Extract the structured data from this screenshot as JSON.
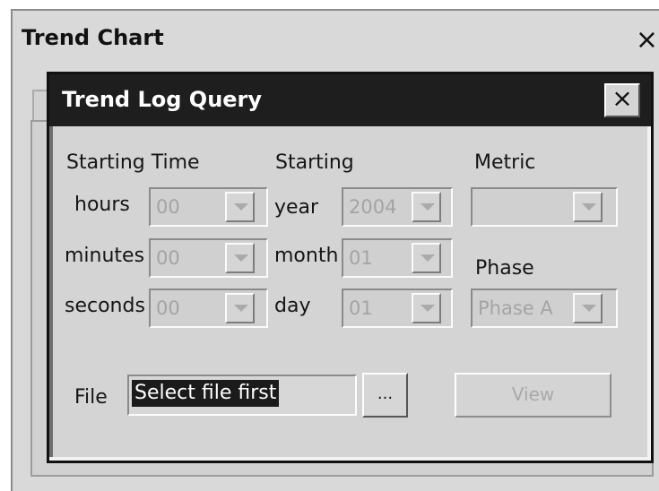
{
  "window": {
    "title": "Trend Chart",
    "close_label": "×"
  },
  "dialog": {
    "title": "Trend Log Query",
    "close_label": "×"
  },
  "sections": {
    "starting_time": "Starting Time",
    "starting": "Starting",
    "metric": "Metric",
    "phase": "Phase"
  },
  "fields": {
    "hours_label": "hours",
    "hours_value": "00",
    "minutes_label": "minutes",
    "minutes_value": "00",
    "seconds_label": "seconds",
    "seconds_value": "00",
    "year_label": "year",
    "year_value": "2004",
    "month_label": "month",
    "month_value": "01",
    "day_label": "day",
    "day_value": "01",
    "metric_value": "",
    "phase_value": "Phase A"
  },
  "file": {
    "label": "File",
    "value": "Select file first",
    "browse_label": "...",
    "view_label": "View"
  },
  "icons": {
    "window_close": "close-icon",
    "dialog_close": "close-icon",
    "dropdown": "chevron-down-icon"
  }
}
